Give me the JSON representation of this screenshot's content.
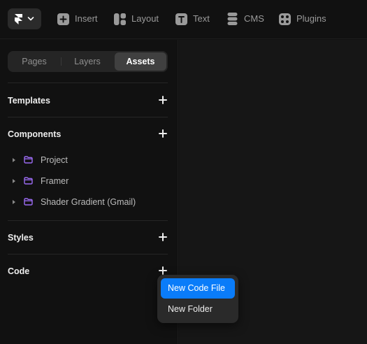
{
  "toolbar": {
    "items": [
      {
        "label": "Insert",
        "icon": "plus-square-icon"
      },
      {
        "label": "Layout",
        "icon": "layout-icon"
      },
      {
        "label": "Text",
        "icon": "text-t-icon"
      },
      {
        "label": "CMS",
        "icon": "database-icon"
      },
      {
        "label": "Plugins",
        "icon": "plugins-icon"
      }
    ]
  },
  "panel": {
    "tabs": [
      "Pages",
      "Layers",
      "Assets"
    ],
    "active_tab": "Assets",
    "sections": {
      "templates": "Templates",
      "components": "Components",
      "styles": "Styles",
      "code": "Code"
    },
    "component_folders": [
      "Project",
      "Framer",
      "Shader Gradient (Gmail)"
    ]
  },
  "code_menu": {
    "items": [
      "New Code File",
      "New Folder"
    ],
    "highlighted": "New Code File"
  },
  "colors": {
    "accent": "#0a7cf9",
    "folder": "#9b6bf2",
    "background": "#111111",
    "canvas": "#161616"
  }
}
